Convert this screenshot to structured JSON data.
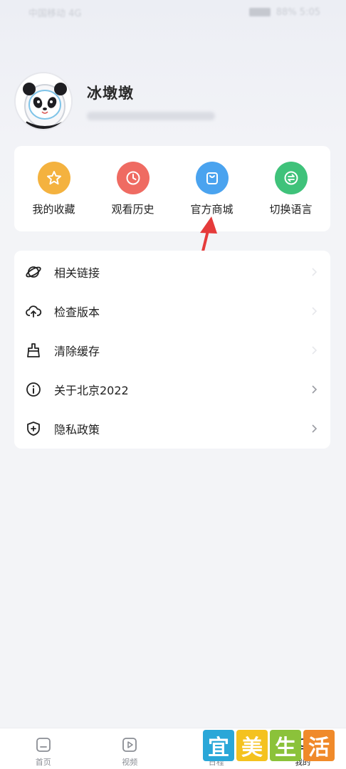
{
  "status_bar": {
    "left_text": "中国移动 4G",
    "right_text": "88% 5:05"
  },
  "profile": {
    "username": "冰墩墩",
    "avatar_icon": "panda-avatar-icon"
  },
  "quick_actions": [
    {
      "label": "我的收藏",
      "icon": "star-icon",
      "color": "#f4b23f"
    },
    {
      "label": "观看历史",
      "icon": "clock-icon",
      "color": "#ef6b62"
    },
    {
      "label": "官方商城",
      "icon": "shopping-bag-icon",
      "color": "#4aa3ef"
    },
    {
      "label": "切换语言",
      "icon": "switch-language-icon",
      "color": "#3fc27a"
    }
  ],
  "menu": [
    {
      "label": "相关链接",
      "icon": "planet-icon"
    },
    {
      "label": "检查版本",
      "icon": "cloud-upload-icon"
    },
    {
      "label": "清除缓存",
      "icon": "broom-icon"
    },
    {
      "label": "关于北京2022",
      "icon": "info-icon"
    },
    {
      "label": "隐私政策",
      "icon": "shield-plus-icon"
    }
  ],
  "tabbar": [
    {
      "label": "首页",
      "icon": "home-icon"
    },
    {
      "label": "视频",
      "icon": "play-icon"
    },
    {
      "label": "日程",
      "icon": "calendar-icon"
    },
    {
      "label": "我的",
      "icon": "user-icon"
    }
  ],
  "watermark": {
    "chars": [
      "宜",
      "美",
      "生",
      "活"
    ],
    "colors": [
      "#2aa7d8",
      "#f4c21f",
      "#8bc23a",
      "#f08a2a"
    ]
  },
  "annotation": {
    "arrow_color": "#e53b3b"
  }
}
